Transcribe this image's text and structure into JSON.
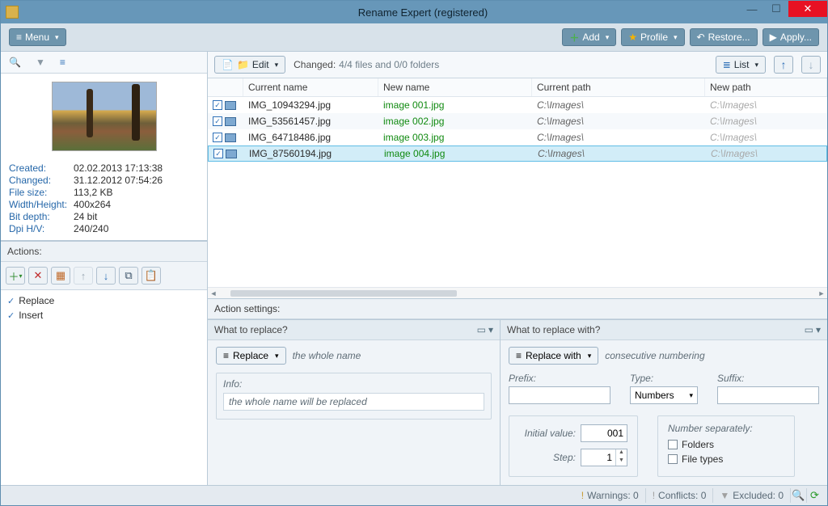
{
  "window": {
    "title": "Rename Expert (registered)"
  },
  "menu": {
    "label": "Menu"
  },
  "top_buttons": {
    "add": "Add",
    "profile": "Profile",
    "restore": "Restore...",
    "apply": "Apply..."
  },
  "edit_btn": "Edit",
  "changed_label": "Changed:",
  "changed_value": "4/4 files and 0/0 folders",
  "list_btn": "List",
  "columns": {
    "current_name": "Current name",
    "new_name": "New name",
    "current_path": "Current path",
    "new_path": "New path"
  },
  "rows": [
    {
      "checked": true,
      "current": "IMG_10943294.jpg",
      "newn": "image 001.jpg",
      "cpath": "C:\\Images\\",
      "npath": "C:\\Images\\"
    },
    {
      "checked": true,
      "current": "IMG_53561457.jpg",
      "newn": "image 002.jpg",
      "cpath": "C:\\Images\\",
      "npath": "C:\\Images\\"
    },
    {
      "checked": true,
      "current": "IMG_64718486.jpg",
      "newn": "image 003.jpg",
      "cpath": "C:\\Images\\",
      "npath": "C:\\Images\\"
    },
    {
      "checked": true,
      "current": "IMG_87560194.jpg",
      "newn": "image 004.jpg",
      "cpath": "C:\\Images\\",
      "npath": "C:\\Images\\"
    }
  ],
  "preview": {
    "labels": {
      "created": "Created:",
      "changed": "Changed:",
      "size": "File size:",
      "wh": "Width/Height:",
      "bit": "Bit depth:",
      "dpi": "Dpi H/V:"
    },
    "values": {
      "created": "02.02.2013 17:13:38",
      "changed": "31.12.2012 07:54:26",
      "size": "113,2 KB",
      "wh": "400x264",
      "bit": "24 bit",
      "dpi": "240/240"
    }
  },
  "actions": {
    "header": "Actions:",
    "items": [
      {
        "label": "Replace"
      },
      {
        "label": "Insert"
      }
    ]
  },
  "settings_header": "Action settings:",
  "what_replace": {
    "title": "What to replace?",
    "btn": "Replace",
    "desc": "the whole name",
    "info_label": "Info:",
    "info_text": "the whole name will be replaced"
  },
  "replace_with": {
    "title": "What to replace with?",
    "btn": "Replace with",
    "desc": "consecutive numbering",
    "prefix_label": "Prefix:",
    "type_label": "Type:",
    "type_value": "Numbers",
    "suffix_label": "Suffix:",
    "initial_label": "Initial value:",
    "initial_value": "001",
    "step_label": "Step:",
    "step_value": "1",
    "separate_hdr": "Number separately:",
    "folders": "Folders",
    "filetypes": "File types"
  },
  "status": {
    "warnings": "Warnings: 0",
    "conflicts": "Conflicts: 0",
    "excluded": "Excluded: 0"
  }
}
